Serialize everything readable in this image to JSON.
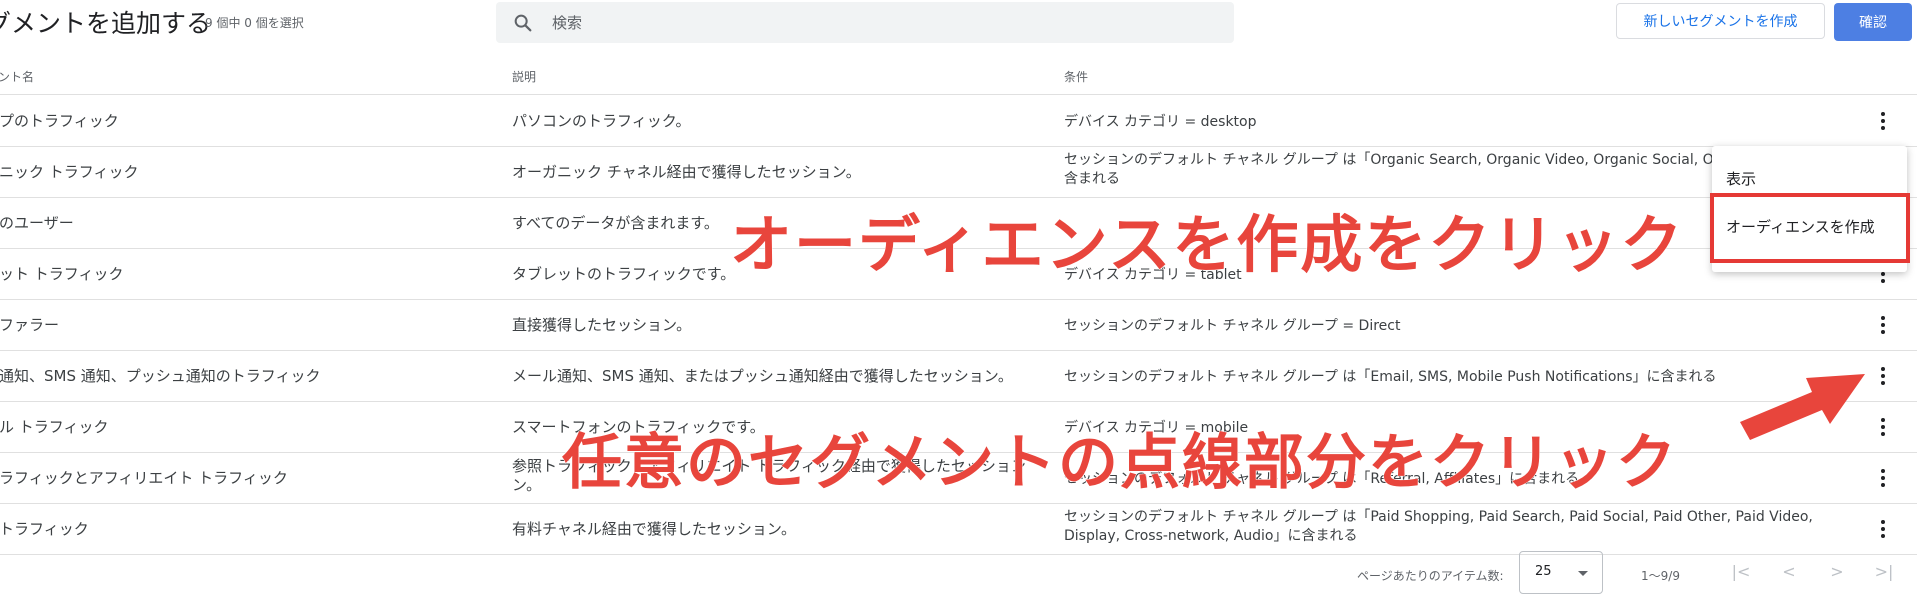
{
  "header": {
    "title": "グメントを追加する",
    "selection_count": "9 個中 0 個を選択",
    "search_placeholder": "検索",
    "search_value": "",
    "new_segment_button": "新しいセグメントを作成",
    "confirm_button": "確認"
  },
  "table": {
    "columns": [
      "ント名",
      "説明",
      "条件"
    ],
    "rows": [
      {
        "name": "ップのトラフィック",
        "description": "パソコンのトラフィック。",
        "condition": "デバイス カテゴリ = desktop"
      },
      {
        "name": "ガニック トラフィック",
        "description": "オーガニック チャネル経由で獲得したセッション。",
        "condition": "セッションのデフォルト チャネル グループ は「Organic Search, Organic Video, Organic Social, Org",
        "condition_line2": "含まれる"
      },
      {
        "name": "てのユーザー",
        "description": "すべてのデータが含まれます。",
        "condition": ""
      },
      {
        "name": "レット トラフィック",
        "description": "タブレットのトラフィックです。",
        "condition": "デバイス カテゴリ = tablet"
      },
      {
        "name": "リファラー",
        "description": "直接獲得したセッション。",
        "condition": "セッションのデフォルト チャネル グループ = Direct"
      },
      {
        "name": "ル通知、SMS 通知、プッシュ通知のトラフィック",
        "description": "メール通知、SMS 通知、またはプッシュ通知経由で獲得したセッション。",
        "condition": "セッションのデフォルト チャネル グループ は「Email, SMS, Mobile Push Notifications」に含まれる"
      },
      {
        "name": "イル トラフィック",
        "description": "スマートフォンのトラフィックです。",
        "condition": "デバイス カテゴリ = mobile"
      },
      {
        "name": "トラフィックとアフィリエイト トラフィック",
        "description": "参照トラフィックとアフィリエイト トラフィック経由で獲得したセッション",
        "description_line2": "ン。",
        "condition": "セッションのデフォルト チャネル グループ は「Referral, Affiliates」に含まれる"
      },
      {
        "name": "のトラフィック",
        "description": "有料チャネル経由で獲得したセッション。",
        "condition": "セッションのデフォルト チャネル グループ は「Paid Shopping, Paid Search, Paid Social, Paid Other, Paid Video,",
        "condition_line2": "Display, Cross-network, Audio」に含まれる"
      }
    ]
  },
  "menu": {
    "view": "表示",
    "create_audience": "オーディエンスを作成"
  },
  "annotations": {
    "top": "オーディエンスを作成をクリック",
    "bottom": "任意のセグメントの点線部分をクリック"
  },
  "pagination": {
    "items_per_page_label": "ページあたりのアイテム数:",
    "items_per_page_value": "25",
    "range": "1～9/9",
    "first": "|<",
    "prev": "<",
    "next": ">",
    "last": ">|"
  },
  "colors": {
    "accent": "#1a73e8",
    "confirm_bg": "#4d7fe3",
    "annotation": "#e8453c"
  }
}
